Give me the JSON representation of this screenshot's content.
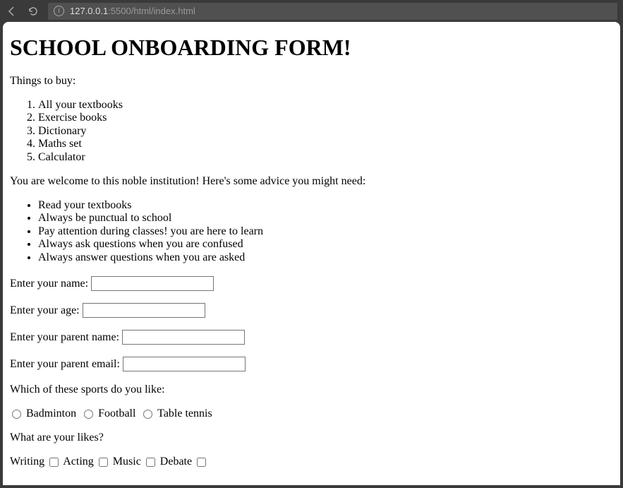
{
  "browser": {
    "url": "127.0.0.1:5500/html/index.html",
    "url_dim_suffix": ":5500/html/index.html",
    "url_host": "127.0.0.1"
  },
  "heading": "SCHOOL ONBOARDING FORM!",
  "things_to_buy_label": "Things to buy:",
  "things_to_buy": [
    "All your textbooks",
    "Exercise books",
    "Dictionary",
    "Maths set",
    "Calculator"
  ],
  "welcome_text": "You are welcome to this noble institution! Here's some advice you might need:",
  "advice": [
    "Read your textbooks",
    "Always be punctual to school",
    "Pay attention during classes! you are here to learn",
    "Always ask questions when you are confused",
    "Always answer questions when you are asked"
  ],
  "form": {
    "name_label": "Enter your name:",
    "age_label": "Enter your age:",
    "parent_name_label": "Enter your parent name:",
    "parent_email_label": "Enter your parent email:",
    "sports_question": "Which of these sports do you like:",
    "sports": [
      "Badminton",
      "Football",
      "Table tennis"
    ],
    "likes_question": "What are your likes?",
    "likes": [
      "Writing",
      "Acting",
      "Music",
      "Debate"
    ]
  }
}
